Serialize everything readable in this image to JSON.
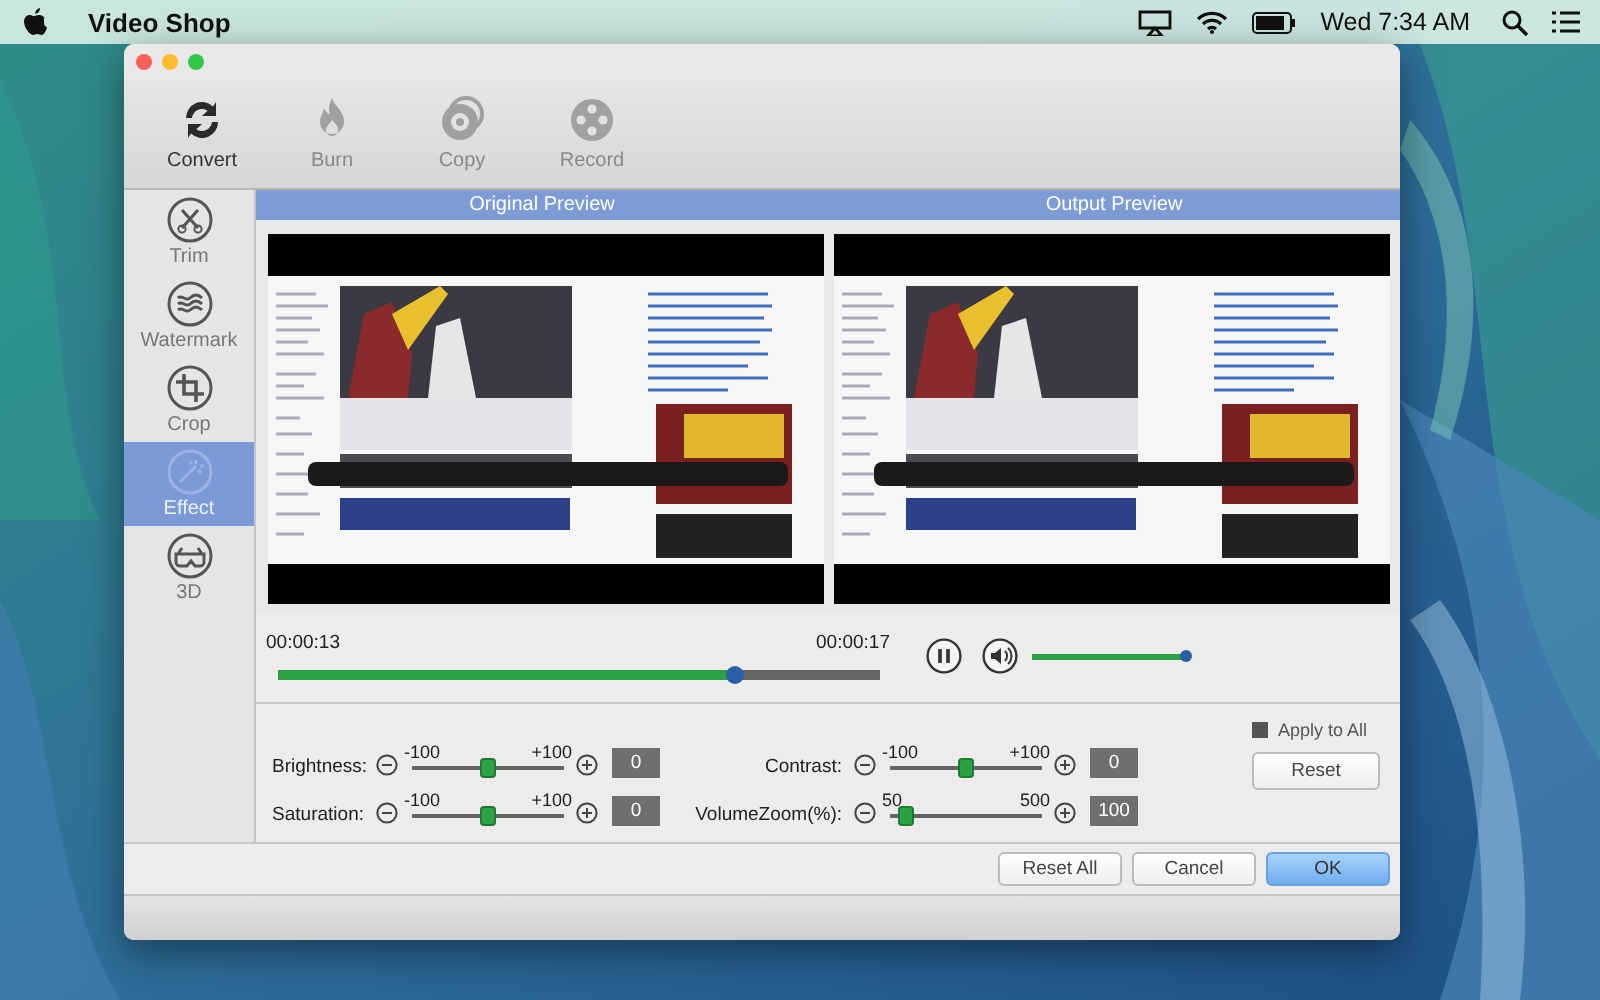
{
  "menu_bar": {
    "app_name": "Video Shop",
    "clock": "Wed 7:34 AM"
  },
  "toolbar": [
    {
      "label": "Convert",
      "kind": "convert",
      "selected": true
    },
    {
      "label": "Burn",
      "kind": "burn",
      "selected": false
    },
    {
      "label": "Copy",
      "kind": "copy",
      "selected": false
    },
    {
      "label": "Record",
      "kind": "record",
      "selected": false
    }
  ],
  "sidebar": [
    {
      "label": "Trim",
      "kind": "trim",
      "selected": false
    },
    {
      "label": "Watermark",
      "kind": "watermark",
      "selected": false
    },
    {
      "label": "Crop",
      "kind": "crop",
      "selected": false
    },
    {
      "label": "Effect",
      "kind": "effect",
      "selected": true
    },
    {
      "label": "3D",
      "kind": "glasses",
      "selected": false
    }
  ],
  "previews": [
    {
      "title": "Original Preview",
      "kind": "picture"
    },
    {
      "title": "Output Preview",
      "kind": "picture"
    }
  ],
  "playback": {
    "current_time": "00:00:13",
    "total_time": "00:00:17",
    "level": 0.76,
    "playing": true,
    "volume": {
      "level": 1.0
    }
  },
  "adjustments": [
    {
      "label": "Brightness:",
      "min": "-100",
      "max": "+100",
      "level": 0.5,
      "value": "0"
    },
    {
      "label": "Contrast:",
      "min": "-100",
      "max": "+100",
      "level": 0.5,
      "value": "0"
    },
    {
      "label": "Saturation:",
      "min": "-100",
      "max": "+100",
      "level": 0.5,
      "value": "0"
    },
    {
      "label": "VolumeZoom(%):",
      "min": "50",
      "max": "500",
      "level": 0.11,
      "value": "100"
    }
  ],
  "apply_to_all": {
    "label": "Apply to All",
    "checked": false
  },
  "reset_button": "Reset",
  "buttons": [
    {
      "label": "Reset All",
      "kind": "normal"
    },
    {
      "label": "Cancel",
      "kind": "normal"
    },
    {
      "label": "OK",
      "kind": "primary"
    }
  ]
}
